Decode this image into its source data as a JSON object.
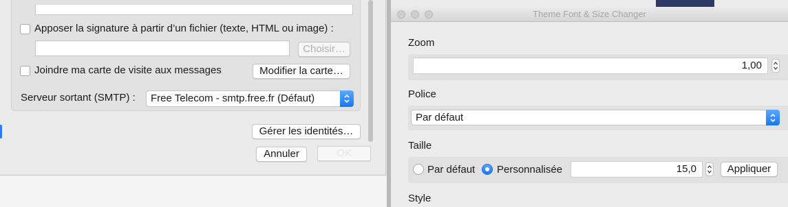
{
  "left_dialog": {
    "signature_from_file_label": "Apposer la signature à partir d’un fichier (texte, HTML ou image) :",
    "signature_file_path": "",
    "choose_button": "Choisir…",
    "vcard_label": "Joindre ma carte de visite aux messages",
    "edit_card_button": "Modifier la carte…",
    "smtp_label": "Serveur sortant (SMTP) :",
    "smtp_value": "Free Telecom - smtp.free.fr (Défaut)",
    "manage_identities_button": "Gérer les identités…",
    "cancel_button": "Annuler",
    "ok_button": "OK"
  },
  "right_window": {
    "title": "Theme Font & Size Changer",
    "zoom_label": "Zoom",
    "zoom_value": "1,00",
    "font_label": "Police",
    "font_value": "Par défaut",
    "size_label": "Taille",
    "size_default_option": "Par défaut",
    "size_custom_option": "Personnalisée",
    "size_selected": "Personnalisée",
    "size_value": "15,0",
    "apply_button": "Appliquer",
    "style_label": "Style"
  },
  "colors": {
    "accent_blue": "#1a76f0"
  }
}
